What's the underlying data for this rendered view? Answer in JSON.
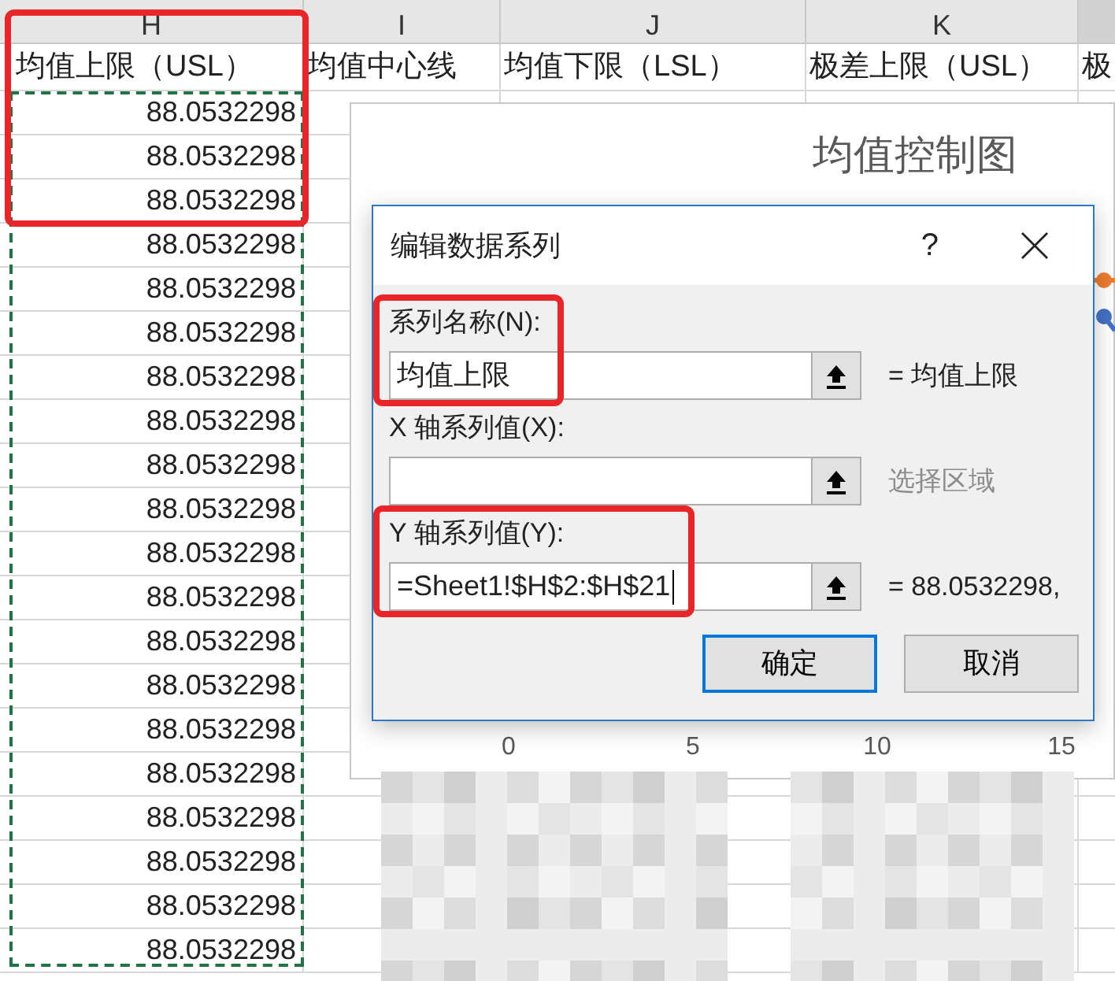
{
  "sheet": {
    "columns": [
      {
        "letter": "H",
        "header": "均值上限（USL）",
        "highlighted": true
      },
      {
        "letter": "I",
        "header": "均值中心线",
        "highlighted": false
      },
      {
        "letter": "J",
        "header": "均值下限（LSL）",
        "highlighted": false
      },
      {
        "letter": "K",
        "header": "极差上限（USL）",
        "highlighted": false
      },
      {
        "header": "极",
        "highlighted": false
      }
    ],
    "h_values": [
      "88.0532298",
      "88.0532298",
      "88.0532298",
      "88.0532298",
      "88.0532298",
      "88.0532298",
      "88.0532298",
      "88.0532298",
      "88.0532298",
      "88.0532298",
      "88.0532298",
      "88.0532298",
      "88.0532298",
      "88.0532298",
      "88.0532298",
      "88.0532298",
      "88.0532298",
      "88.0532298",
      "88.0532298",
      "88.0532298"
    ],
    "copy_marquee": true
  },
  "chart": {
    "title": "均值控制图",
    "x_tick_labels": [
      "0",
      "5",
      "10",
      "15"
    ],
    "series": [
      {
        "color": "#ed7d31"
      },
      {
        "color": "#4472c4"
      }
    ]
  },
  "dialog": {
    "title": "编辑数据系列",
    "help": "?",
    "fields": [
      {
        "label": "系列名称(N):",
        "value": "均值上限",
        "preview": "= 均值上限",
        "preview_dim": false,
        "caret": false,
        "highlighted": true
      },
      {
        "label": "X 轴系列值(X):",
        "preview": "选择区域",
        "preview_dim": true,
        "caret": false,
        "highlighted": false
      },
      {
        "label": "Y 轴系列值(Y):",
        "value": "=Sheet1!$H$2:$H$21",
        "preview": "= 88.0532298,",
        "preview_dim": false,
        "caret": true,
        "highlighted": true
      }
    ],
    "buttons": [
      {
        "label": "确定",
        "focused": true
      },
      {
        "label": "取消",
        "focused": false
      }
    ]
  }
}
